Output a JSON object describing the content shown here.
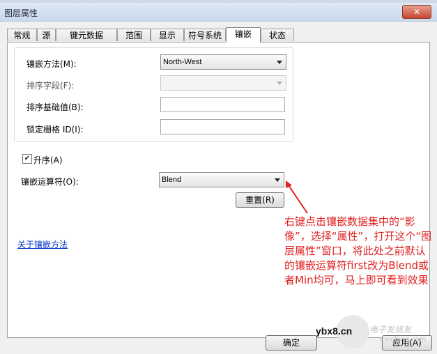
{
  "window": {
    "title": "图层属性",
    "close_glyph": "✕"
  },
  "tabs": [
    "常规",
    "源",
    "键元数据",
    "范围",
    "显示",
    "符号系统",
    "镶嵌",
    "状态"
  ],
  "active_tab": "镶嵌",
  "mosaic": {
    "method_label": "镶嵌方法(M):",
    "method_value": "North-West",
    "sort_field_label": "排序字段(F):",
    "sort_base_label": "排序基础值(B):",
    "lock_raster_label": "锁定栅格 ID(I):",
    "ascending_label": "升序(A)",
    "ascending_checked": true,
    "operator_label": "镶嵌运算符(O):",
    "operator_value": "Blend",
    "reset_button": "重置(R)",
    "about_link": "关于镶嵌方法"
  },
  "footer": {
    "ok_button": "确定",
    "apply_button": "应用(A)"
  },
  "annotation": {
    "text": "右键点击镶嵌数据集中的“影像”，选择“属性”，打开这个“图层属性”窗口，将此处之前默认的镶嵌运算符first改为Blend或者Min均可，马上即可看到效果",
    "color": "#e02020"
  },
  "watermark": {
    "site": "ybx8.cn",
    "brand": "电子发烧友",
    "url": "elecfans.com"
  }
}
